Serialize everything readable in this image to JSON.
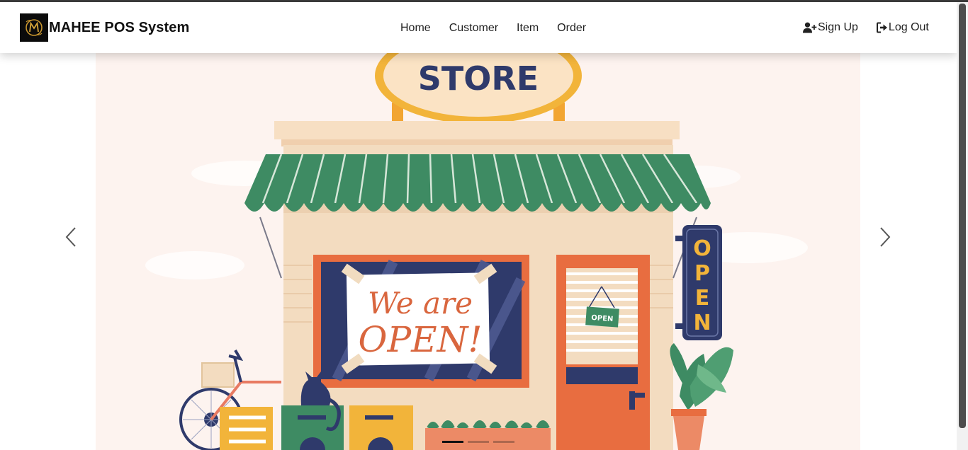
{
  "brand": {
    "title": "MAHEE POS System",
    "logo_icon": "m-letter-logo-icon"
  },
  "nav": {
    "links": [
      {
        "label": "Home"
      },
      {
        "label": "Customer"
      },
      {
        "label": "Item"
      },
      {
        "label": "Order"
      }
    ],
    "signup_label": "Sign Up",
    "logout_label": "Log Out"
  },
  "carousel": {
    "prev_icon": "chevron-left-icon",
    "next_icon": "chevron-right-icon",
    "active_slide": 1,
    "slide_count": 3,
    "slide": {
      "store_sign": "STORE",
      "window_text_line1": "We are",
      "window_text_line2": "OPEN!",
      "door_sign": "OPEN",
      "vertical_sign": [
        "O",
        "P",
        "E",
        "N"
      ]
    }
  },
  "colors": {
    "navbar_bg": "#ffffff",
    "slide_bg": "#fdf3ef",
    "awning_green": "#3e8b63",
    "sign_navy": "#2f3a6b",
    "door_orange": "#e86d40",
    "accent_yellow": "#f2b43a"
  }
}
